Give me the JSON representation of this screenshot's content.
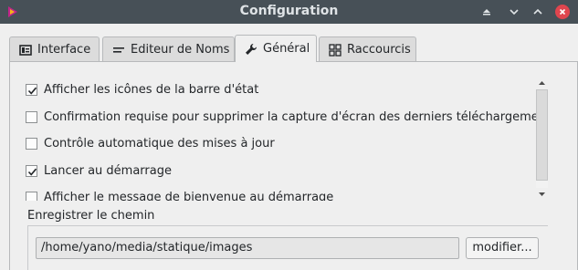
{
  "window": {
    "title": "Configuration"
  },
  "tabs": [
    {
      "label": "Interface",
      "icon": "interface-icon",
      "active": false
    },
    {
      "label": "Editeur de Noms",
      "icon": "list-icon",
      "active": false
    },
    {
      "label": "Général",
      "icon": "wrench-icon",
      "active": true
    },
    {
      "label": "Raccourcis",
      "icon": "grid-icon",
      "active": false
    }
  ],
  "general": {
    "options": [
      {
        "label": "Afficher les icônes de la barre d'état",
        "checked": true
      },
      {
        "label": "Confirmation requise pour supprimer la capture d'écran des derniers téléchargements",
        "checked": false
      },
      {
        "label": "Contrôle automatique des mises à jour",
        "checked": false
      },
      {
        "label": "Lancer au démarrage",
        "checked": true
      },
      {
        "label": "Afficher le message de bienvenue au démarrage",
        "checked": false
      }
    ],
    "save_path_label": "Enregistrer le chemin",
    "save_path_value": "/home/yano/media/statique/images",
    "browse_label": "modifier..."
  },
  "colors": {
    "titlebar": "#475057",
    "close_button": "#e0454e"
  }
}
